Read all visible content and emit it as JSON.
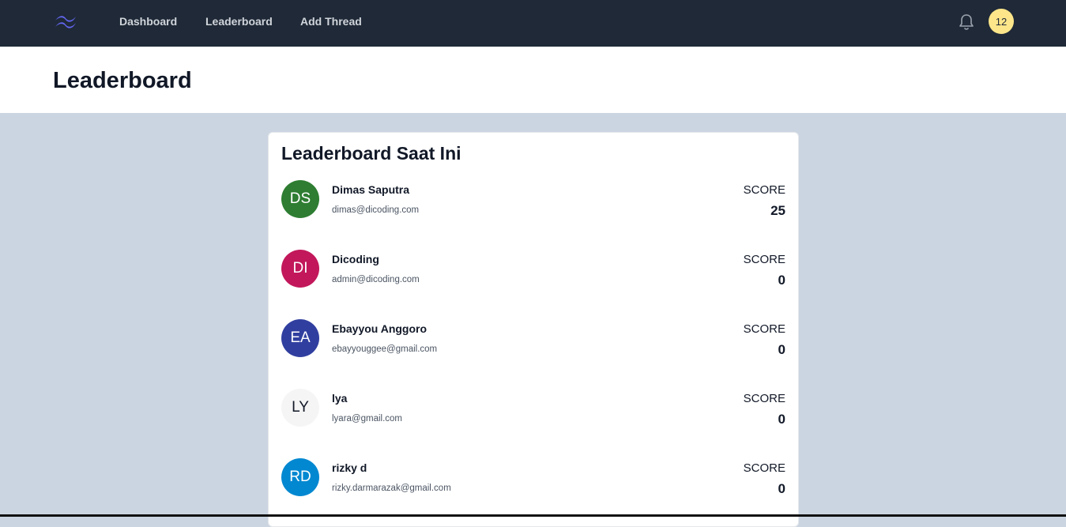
{
  "navbar": {
    "logo_icon": "tailwind-wave-logo",
    "links": [
      {
        "label": "Dashboard"
      },
      {
        "label": "Leaderboard"
      },
      {
        "label": "Add Thread"
      }
    ],
    "notification_icon": "bell-icon",
    "avatar_label": "12"
  },
  "header": {
    "title": "Leaderboard"
  },
  "leaderboard": {
    "title": "Leaderboard Saat Ini",
    "entries": [
      {
        "initials": "DS",
        "name": "Dimas Saputra",
        "email": "dimas@dicoding.com",
        "score_label": "SCORE",
        "score": "25",
        "avatar_color": "#2e7d32",
        "text_color": "#ffffff"
      },
      {
        "initials": "DI",
        "name": "Dicoding",
        "email": "admin@dicoding.com",
        "score_label": "SCORE",
        "score": "0",
        "avatar_color": "#c2185b",
        "text_color": "#ffffff"
      },
      {
        "initials": "EA",
        "name": "Ebayyou Anggoro",
        "email": "ebayyouggee@gmail.com",
        "score_label": "SCORE",
        "score": "0",
        "avatar_color": "#303f9f",
        "text_color": "#ffffff"
      },
      {
        "initials": "LY",
        "name": "lya",
        "email": "lyara@gmail.com",
        "score_label": "SCORE",
        "score": "0",
        "avatar_color": "#f5f5f5",
        "text_color": "#111827"
      },
      {
        "initials": "RD",
        "name": "rizky d",
        "email": "rizky.darmarazak@gmail.com",
        "score_label": "SCORE",
        "score": "0",
        "avatar_color": "#0288d1",
        "text_color": "#ffffff"
      }
    ]
  },
  "colors": {
    "navbar_bg": "#1f2937",
    "page_bg": "#cbd5e1",
    "badge_bg": "#fde68a"
  }
}
